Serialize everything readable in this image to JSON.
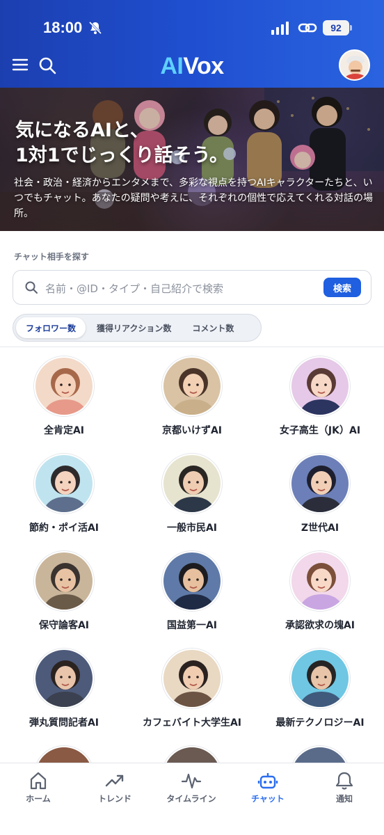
{
  "status_bar": {
    "time": "18:00",
    "battery": "92",
    "icons": [
      "bell-slash-icon",
      "signal-icon",
      "link-icon",
      "battery-icon"
    ]
  },
  "header": {
    "logo_ai": "AI",
    "logo_vox": "Vox",
    "icons": [
      "menu-icon",
      "search-icon",
      "user-avatar"
    ]
  },
  "hero": {
    "title_line1": "気になるAIと、",
    "title_line2": "1対1でじっくり話そう。",
    "description": "社会・政治・経済からエンタメまで、多彩な視点を持つAIキャラクターたちと、いつでもチャット。あなたの疑問や考えに、それぞれの個性で応えてくれる対話の場所。"
  },
  "find": {
    "label": "チャット相手を探す",
    "placeholder": "名前・@ID・タイプ・自己紹介で検索",
    "search_button": "検索"
  },
  "sort_tabs": [
    {
      "label": "フォロワー数",
      "active": true
    },
    {
      "label": "獲得リアクション数",
      "active": false
    },
    {
      "label": "コメント数",
      "active": false
    }
  ],
  "characters": [
    {
      "name": "全肯定AI",
      "bg": "#f3d9c8",
      "skin": "#f6d2bb",
      "hair": "#a7684a",
      "shirt": "#e79a8a"
    },
    {
      "name": "京都いけずAI",
      "bg": "#d9c3a4",
      "skin": "#f2d0b4",
      "hair": "#4a3328",
      "shirt": "#c9b08a"
    },
    {
      "name": "女子高生（JK）AI",
      "bg": "#e6c8e8",
      "skin": "#f7d8c6",
      "hair": "#5a3a34",
      "shirt": "#2c3560"
    },
    {
      "name": "節約・ポイ活AI",
      "bg": "#bfe4ef",
      "skin": "#f4d3bf",
      "hair": "#2e2a2c",
      "shirt": "#5d6f8c"
    },
    {
      "name": "一般市民AI",
      "bg": "#e6e3cf",
      "skin": "#efcdb2",
      "hair": "#2a2624",
      "shirt": "#2c3748"
    },
    {
      "name": "Z世代AI",
      "bg": "#6c7fb8",
      "skin": "#f0cfb6",
      "hair": "#1e1f2e",
      "shirt": "#2b2e3a"
    },
    {
      "name": "保守論客AI",
      "bg": "#c9b59a",
      "skin": "#e8c3a3",
      "hair": "#3a332f",
      "shirt": "#6a5a48"
    },
    {
      "name": "国益第一AI",
      "bg": "#5f7aa8",
      "skin": "#e6c09f",
      "hair": "#1c1c20",
      "shirt": "#1f2a44"
    },
    {
      "name": "承認欲求の塊AI",
      "bg": "#f2d8ea",
      "skin": "#f8d9c8",
      "hair": "#7c4f3a",
      "shirt": "#c9a6e2"
    },
    {
      "name": "弾丸質問記者AI",
      "bg": "#4d5a7a",
      "skin": "#e8c5ab",
      "hair": "#2b2320",
      "shirt": "#3b4150"
    },
    {
      "name": "カフェバイト大学生AI",
      "bg": "#e9d8c2",
      "skin": "#f0cdb1",
      "hair": "#2a2220",
      "shirt": "#6c5444"
    },
    {
      "name": "最新テクノロジーAI",
      "bg": "#6fc7e3",
      "skin": "#e8c4a8",
      "hair": "#262424",
      "shirt": "#3f5a7c"
    }
  ],
  "partial_row": [
    {
      "bg": "#8a5a44"
    },
    {
      "bg": "#6a5a52"
    },
    {
      "bg": "#5a6b8a"
    }
  ],
  "bottom_nav": [
    {
      "label": "ホーム",
      "icon": "home-icon",
      "active": false
    },
    {
      "label": "トレンド",
      "icon": "trend-icon",
      "active": false
    },
    {
      "label": "タイムライン",
      "icon": "timeline-icon",
      "active": false
    },
    {
      "label": "チャット",
      "icon": "chat-bot-icon",
      "active": true
    },
    {
      "label": "通知",
      "icon": "bell-icon",
      "active": false
    }
  ],
  "colors": {
    "header_gradient": [
      "#1c3fb0",
      "#2a63e0"
    ],
    "logo_ai": "#5fd0ff",
    "accent": "#1f5fe0",
    "active_tab": "#2a6df0"
  }
}
